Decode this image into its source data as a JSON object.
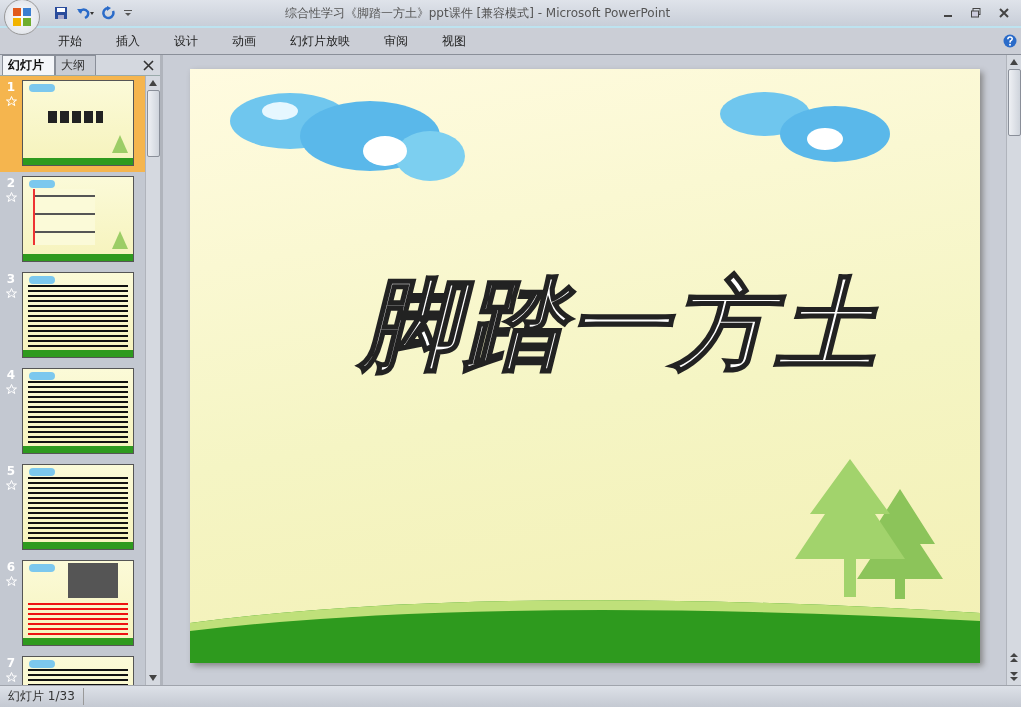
{
  "window": {
    "title": "综合性学习《脚踏一方土》ppt课件 [兼容模式] - Microsoft PowerPoint"
  },
  "ribbon_tabs": [
    {
      "label": "开始"
    },
    {
      "label": "插入"
    },
    {
      "label": "设计"
    },
    {
      "label": "动画"
    },
    {
      "label": "幻灯片放映"
    },
    {
      "label": "审阅"
    },
    {
      "label": "视图"
    }
  ],
  "panel_tabs": [
    {
      "label": "幻灯片",
      "selected": true
    },
    {
      "label": "大纲",
      "selected": false
    }
  ],
  "thumbnails": [
    {
      "number": "1",
      "selected": true,
      "kind": "title"
    },
    {
      "number": "2",
      "selected": false,
      "kind": "diagram"
    },
    {
      "number": "3",
      "selected": false,
      "kind": "text"
    },
    {
      "number": "4",
      "selected": false,
      "kind": "text"
    },
    {
      "number": "5",
      "selected": false,
      "kind": "text"
    },
    {
      "number": "6",
      "selected": false,
      "kind": "photo"
    },
    {
      "number": "7",
      "selected": false,
      "kind": "text"
    }
  ],
  "slide": {
    "title": "脚踏一方土"
  },
  "status_bar": {
    "slide_counter": "幻灯片 1/33"
  }
}
